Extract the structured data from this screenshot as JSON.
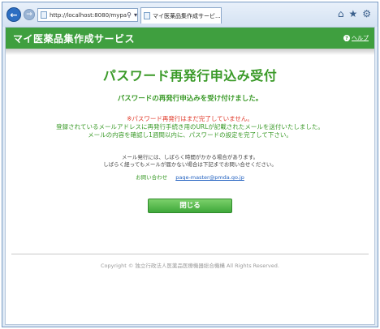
{
  "browser": {
    "address": "http://localhost:8080/mypa",
    "address_tools": [
      "⚲",
      "▾",
      "C"
    ],
    "tab_title": "マイ医薬品集作成サービ...",
    "tab_close": "×",
    "icons": [
      "home-icon",
      "star-icon",
      "gear-icon"
    ]
  },
  "header": {
    "title": "マイ医薬品集作成サービス",
    "help_label": "ヘルプ",
    "help_icon": "?",
    "color": "#3f9f3f"
  },
  "main": {
    "page_title": "パスワード再発行申込み受付",
    "subtitle": "パスワードの再発行申込みを受け付けました。",
    "warning": "※パスワード再発行はまだ完了していません。",
    "info_lines": [
      "登録されているメールアドレスに再発行手続き用のURLが記載されたメールを送付いたしました。",
      "メールの内容を確認し1週間以内に、パスワードの設定を完了して下さい。"
    ],
    "notes": [
      "メール発行には、しばらく時間がかかる場合があります。",
      "しばらく経ってもメールが届かない場合は下記までお問い合せください。"
    ],
    "contact_label": "お問い合わせ",
    "contact_email": "page-master@pmda.go.jp",
    "close_button": "閉じる"
  },
  "footer": {
    "copyright": "Copyright © 独立行政法人医薬品医療機器総合機構 All Rights Reserved."
  }
}
